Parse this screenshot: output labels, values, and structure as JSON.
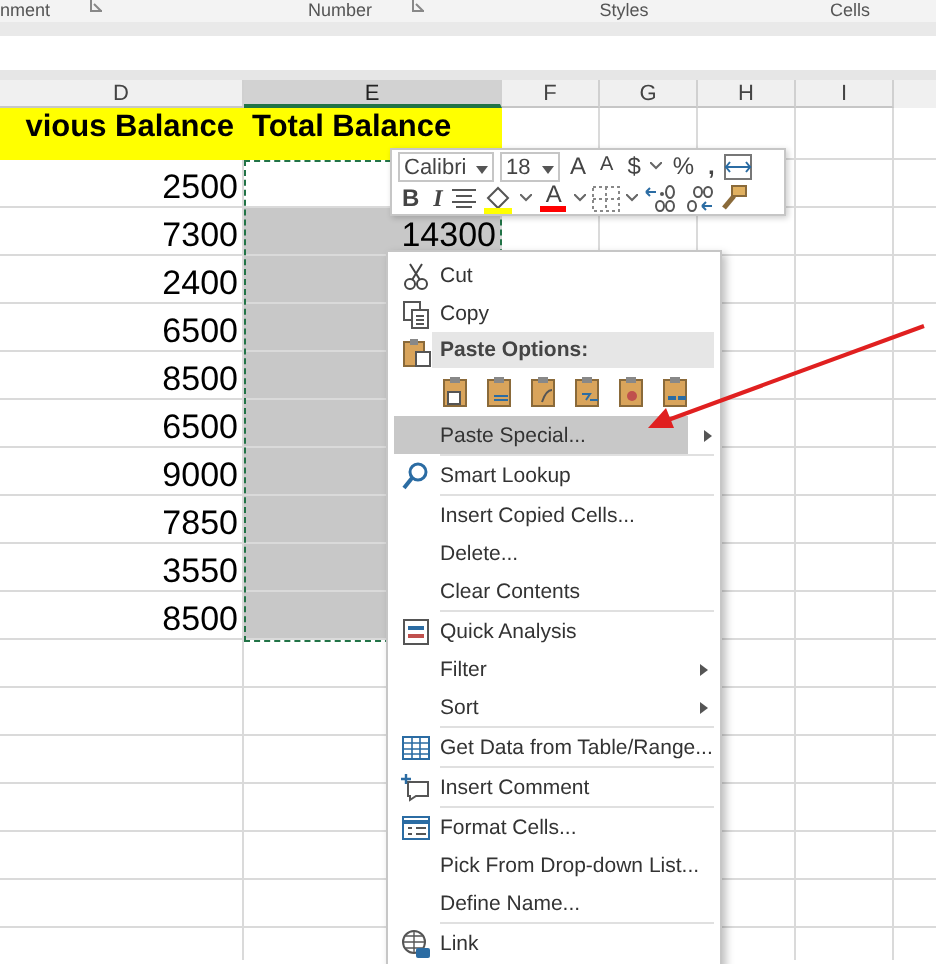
{
  "ribbon_groups": [
    {
      "label": "nment",
      "launcher": true
    },
    {
      "label": "Number",
      "launcher": true
    },
    {
      "label": "Styles",
      "launcher": false
    },
    {
      "label": "Cells",
      "launcher": false
    }
  ],
  "columns": [
    {
      "label": "D",
      "selected": false
    },
    {
      "label": "E",
      "selected": true
    },
    {
      "label": "F",
      "selected": false
    },
    {
      "label": "G",
      "selected": false
    },
    {
      "label": "H",
      "selected": false
    },
    {
      "label": "I",
      "selected": false
    }
  ],
  "header_row": [
    "vious Balance",
    "Total Balance"
  ],
  "rows": [
    {
      "previous": "2500",
      "total": "",
      "selected": false
    },
    {
      "previous": "7300",
      "total": "14300",
      "selected": true
    },
    {
      "previous": "2400",
      "total": "",
      "selected": true
    },
    {
      "previous": "6500",
      "total": "",
      "selected": true
    },
    {
      "previous": "8500",
      "total": "",
      "selected": true
    },
    {
      "previous": "6500",
      "total": "",
      "selected": true
    },
    {
      "previous": "9000",
      "total": "",
      "selected": true
    },
    {
      "previous": "7850",
      "total": "",
      "selected": true
    },
    {
      "previous": "3550",
      "total": "",
      "selected": true
    },
    {
      "previous": "8500",
      "total": "",
      "selected": true
    }
  ],
  "mini_toolbar": {
    "row1": [
      {
        "kind": "font",
        "value": "Calibri"
      },
      {
        "kind": "size",
        "value": "18"
      },
      {
        "kind": "grow",
        "label": "A"
      },
      {
        "kind": "shrink",
        "label": "A"
      },
      {
        "kind": "glyph",
        "label": "$"
      },
      {
        "kind": "caret"
      },
      {
        "kind": "glyph",
        "label": "%"
      },
      {
        "kind": "comma",
        "label": ","
      },
      {
        "kind": "wrap"
      }
    ],
    "row2": [
      {
        "kind": "bold",
        "label": "B"
      },
      {
        "kind": "italic",
        "label": "I"
      },
      {
        "kind": "align"
      },
      {
        "kind": "fill",
        "color": "#ffff00"
      },
      {
        "kind": "caret"
      },
      {
        "kind": "fontcolor",
        "label": "A",
        "color": "#ff0000"
      },
      {
        "kind": "caret"
      },
      {
        "kind": "borders"
      },
      {
        "kind": "caret"
      },
      {
        "kind": "incdec"
      },
      {
        "kind": "decdec"
      },
      {
        "kind": "painter"
      }
    ]
  },
  "context_menu": {
    "items": [
      {
        "kind": "item",
        "label": "Cut",
        "submenu": false,
        "selected": false
      },
      {
        "kind": "item",
        "label": "Copy",
        "submenu": false,
        "selected": false
      },
      {
        "kind": "header",
        "label": "Paste Options:"
      },
      {
        "kind": "paste_row"
      },
      {
        "kind": "item",
        "label": "Paste Special...",
        "submenu": true,
        "selected": true
      },
      {
        "kind": "separator"
      },
      {
        "kind": "item",
        "label": "Smart Lookup",
        "submenu": false,
        "selected": false
      },
      {
        "kind": "separator"
      },
      {
        "kind": "item",
        "label": "Insert Copied Cells...",
        "submenu": false,
        "selected": false
      },
      {
        "kind": "item",
        "label": "Delete...",
        "submenu": false,
        "selected": false
      },
      {
        "kind": "item",
        "label": "Clear Contents",
        "submenu": false,
        "selected": false
      },
      {
        "kind": "separator"
      },
      {
        "kind": "item",
        "label": "Quick Analysis",
        "submenu": false,
        "selected": false
      },
      {
        "kind": "item",
        "label": "Filter",
        "submenu": true,
        "selected": false
      },
      {
        "kind": "item",
        "label": "Sort",
        "submenu": true,
        "selected": false
      },
      {
        "kind": "separator"
      },
      {
        "kind": "item",
        "label": "Get Data from Table/Range...",
        "submenu": false,
        "selected": false
      },
      {
        "kind": "separator"
      },
      {
        "kind": "item",
        "label": "Insert Comment",
        "submenu": false,
        "selected": false
      },
      {
        "kind": "separator"
      },
      {
        "kind": "item",
        "label": "Format Cells...",
        "submenu": false,
        "selected": false
      },
      {
        "kind": "item",
        "label": "Pick From Drop-down List...",
        "submenu": false,
        "selected": false
      },
      {
        "kind": "item",
        "label": "Define Name...",
        "submenu": false,
        "selected": false
      },
      {
        "kind": "separator"
      },
      {
        "kind": "item",
        "label": "Link",
        "submenu": false,
        "selected": false
      }
    ]
  }
}
